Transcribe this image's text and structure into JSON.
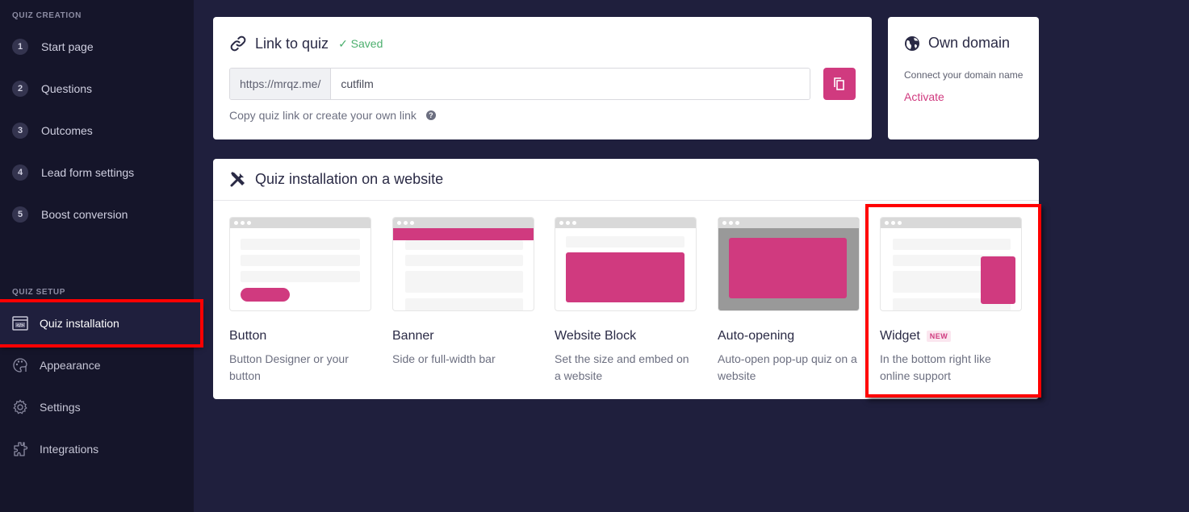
{
  "sidebar": {
    "creation_title": "QUIZ CREATION",
    "steps": [
      {
        "num": "1",
        "label": "Start page"
      },
      {
        "num": "2",
        "label": "Questions"
      },
      {
        "num": "3",
        "label": "Outcomes"
      },
      {
        "num": "4",
        "label": "Lead form settings"
      },
      {
        "num": "5",
        "label": "Boost conversion"
      }
    ],
    "setup_title": "QUIZ SETUP",
    "setup_items": [
      {
        "label": "Quiz installation",
        "icon": "code-window-icon",
        "active": true
      },
      {
        "label": "Appearance",
        "icon": "palette-icon"
      },
      {
        "label": "Settings",
        "icon": "gear-icon"
      },
      {
        "label": "Integrations",
        "icon": "puzzle-icon"
      }
    ]
  },
  "link_card": {
    "title": "Link to quiz",
    "saved_status": "✓ Saved",
    "url_prefix": "https://mrqz.me/",
    "slug_value": "cutfilm",
    "helper_text": "Copy quiz link or create your own link",
    "help_icon": "?"
  },
  "domain_card": {
    "title": "Own domain",
    "subtitle": "Connect your domain name",
    "action": "Activate"
  },
  "install_card": {
    "title": "Quiz installation on a website",
    "options": [
      {
        "title": "Button",
        "desc": "Button Designer or your button"
      },
      {
        "title": "Banner",
        "desc": "Side or full-width bar"
      },
      {
        "title": "Website Block",
        "desc": "Set the size and embed on a website"
      },
      {
        "title": "Auto-opening",
        "desc": "Auto-open pop-up quiz on a website"
      },
      {
        "title": "Widget",
        "desc": "In the bottom right like online support",
        "badge": "NEW"
      }
    ]
  },
  "colors": {
    "accent": "#d03a7f",
    "sidebar_bg": "#15152a",
    "page_bg": "#1f1f3d",
    "saved_green": "#4caf6e",
    "highlight_red": "#ff0000"
  }
}
